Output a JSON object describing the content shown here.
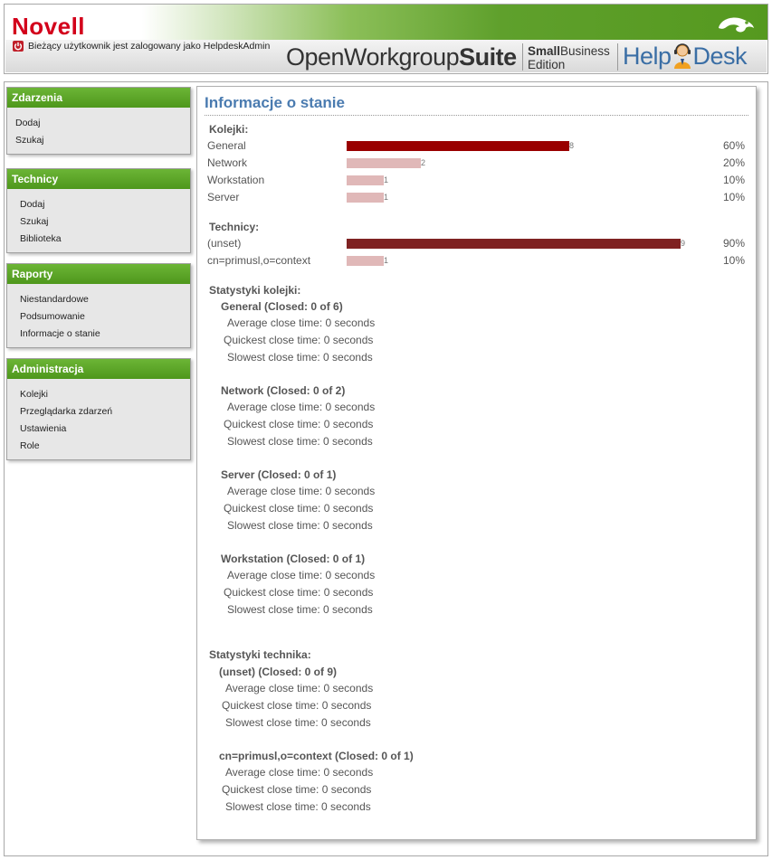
{
  "header": {
    "logo": "Novell",
    "user_status": "Bieżący użytkownik jest zalogowany jako HelpdeskAdmin",
    "suite_light": "OpenWorkgroup",
    "suite_bold": "Suite",
    "edition_line1_a": "Small",
    "edition_line1_b": "Business",
    "edition_line2": "Edition",
    "helpdesk_a": "Help",
    "helpdesk_b": "Desk",
    "accent_color": "#5fa02c"
  },
  "sidebar": {
    "panels": [
      {
        "title": "Zdarzenia",
        "items": [
          "Dodaj",
          "Szukaj"
        ]
      },
      {
        "title": "Technicy",
        "items": [
          "Dodaj",
          "Szukaj",
          "Biblioteka"
        ]
      },
      {
        "title": "Raporty",
        "items": [
          "Niestandardowe",
          "Podsumowanie",
          "Informacje o stanie"
        ]
      },
      {
        "title": "Administracja",
        "items": [
          "Kolejki",
          "Przeglądarka zdarzeń",
          "Ustawienia",
          "Role"
        ]
      }
    ]
  },
  "main": {
    "title": "Informacje o stanie",
    "queues_label": "Kolejki:",
    "queues": [
      {
        "name": "General",
        "count": "8",
        "percent": "60%",
        "fraction": 0.6,
        "color": "#990000"
      },
      {
        "name": "Network",
        "count": "2",
        "percent": "20%",
        "fraction": 0.2,
        "color": "#e0b8b8"
      },
      {
        "name": "Workstation",
        "count": "1",
        "percent": "10%",
        "fraction": 0.1,
        "color": "#e0b8b8"
      },
      {
        "name": "Server",
        "count": "1",
        "percent": "10%",
        "fraction": 0.1,
        "color": "#e0b8b8"
      }
    ],
    "techs_label": "Technicy:",
    "techs": [
      {
        "name": "(unset)",
        "count": "9",
        "percent": "90%",
        "fraction": 0.9,
        "color": "#7f2222"
      },
      {
        "name": "cn=primusl,o=context",
        "count": "1",
        "percent": "10%",
        "fraction": 0.1,
        "color": "#e0b8b8"
      }
    ],
    "queue_stats_label": "Statystyki kolejki:",
    "queue_stats": [
      {
        "heading": "General (Closed: 0 of 6)",
        "avg": "Average close time: 0 seconds",
        "quick": "Quickest close time: 0 seconds",
        "slow": "Slowest close time: 0 seconds"
      },
      {
        "heading": "Network (Closed: 0 of 2)",
        "avg": "Average close time: 0 seconds",
        "quick": "Quickest close time: 0 seconds",
        "slow": "Slowest close time: 0 seconds"
      },
      {
        "heading": "Server (Closed: 0 of 1)",
        "avg": "Average close time: 0 seconds",
        "quick": "Quickest close time: 0 seconds",
        "slow": "Slowest close time: 0 seconds"
      },
      {
        "heading": "Workstation (Closed: 0 of 1)",
        "avg": "Average close time: 0 seconds",
        "quick": "Quickest close time: 0 seconds",
        "slow": "Slowest close time: 0 seconds"
      }
    ],
    "tech_stats_label": "Statystyki technika:",
    "tech_stats": [
      {
        "heading": "(unset) (Closed: 0 of 9)",
        "avg": "Average close time: 0 seconds",
        "quick": "Quickest close time: 0 seconds",
        "slow": "Slowest close time: 0 seconds"
      },
      {
        "heading": "cn=primusl,o=context (Closed: 0 of 1)",
        "avg": "Average close time: 0 seconds",
        "quick": "Quickest close time: 0 seconds",
        "slow": "Slowest close time: 0 seconds"
      }
    ]
  }
}
